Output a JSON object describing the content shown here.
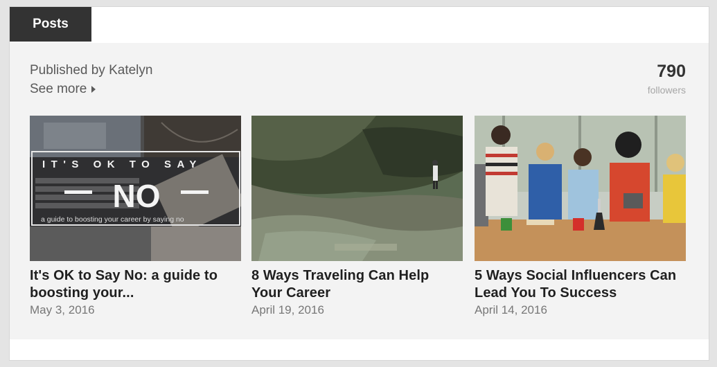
{
  "tabs": [
    {
      "label": "Posts",
      "active": true
    }
  ],
  "header": {
    "published_by": "Published by Katelyn",
    "see_more": "See more",
    "followers_count": "790",
    "followers_label": "followers"
  },
  "posts": [
    {
      "title": "It's OK to Say No: a guide to boosting your...",
      "date": "May 3, 2016",
      "image": {
        "headline_top": "IT'S OK TO SAY",
        "headline_main": "NO",
        "tagline": "a guide to boosting your career by saying no"
      }
    },
    {
      "title": "8 Ways Traveling Can Help Your Career",
      "date": "April 19, 2016"
    },
    {
      "title": "5 Ways Social Influencers Can Lead You To Success",
      "date": "April 14, 2016"
    }
  ],
  "colors": {
    "tab_bg": "#333333",
    "panel_bg": "#f3f3f3",
    "title_text": "#1f1f1f",
    "meta_text": "#777777"
  }
}
